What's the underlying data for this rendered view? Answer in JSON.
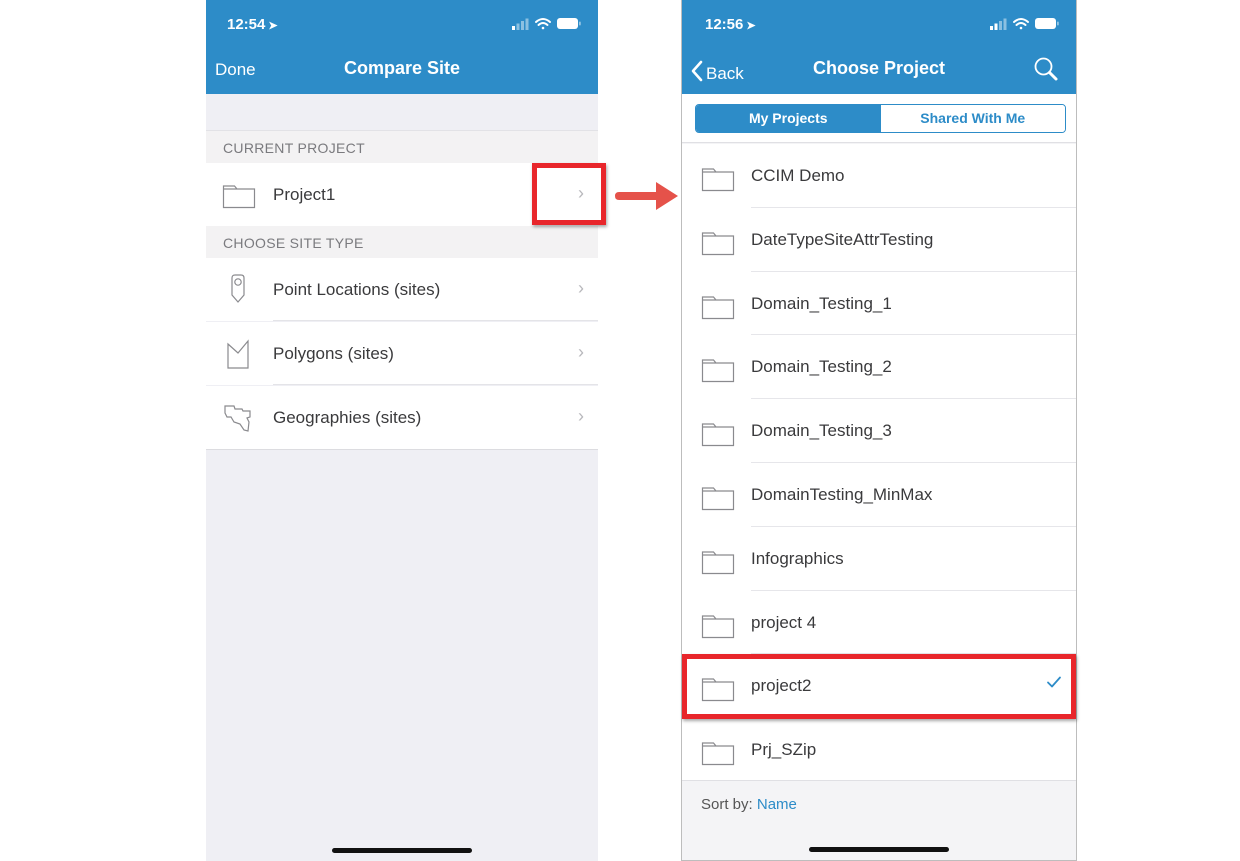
{
  "left_screen": {
    "status_bar": {
      "time": "12:54",
      "location_icon": "location-arrow-icon",
      "signal_icon": "cellular-signal-icon",
      "wifi_icon": "wifi-icon",
      "battery_icon": "battery-icon"
    },
    "nav": {
      "left_button": "Done",
      "title": "Compare Site"
    },
    "sections": {
      "current_project": {
        "header": "CURRENT PROJECT",
        "item": {
          "label": "Project1",
          "icon": "folder-icon",
          "accessory": "chevron-right-icon"
        }
      },
      "choose_site_type": {
        "header": "CHOOSE SITE TYPE",
        "items": [
          {
            "label": "Point Locations (sites)",
            "icon": "map-pin-icon",
            "accessory": "chevron-right-icon"
          },
          {
            "label": "Polygons (sites)",
            "icon": "polygon-icon",
            "accessory": "chevron-right-icon"
          },
          {
            "label": "Geographies (sites)",
            "icon": "geography-shape-icon",
            "accessory": "chevron-right-icon"
          }
        ]
      }
    }
  },
  "right_screen": {
    "status_bar": {
      "time": "12:56",
      "location_icon": "location-arrow-icon",
      "signal_icon": "cellular-signal-icon",
      "wifi_icon": "wifi-icon",
      "battery_icon": "battery-icon"
    },
    "nav": {
      "back_label": "Back",
      "title": "Choose Project",
      "right_icon": "search-icon"
    },
    "segments": [
      {
        "label": "My Projects",
        "selected": true
      },
      {
        "label": "Shared With Me",
        "selected": false
      }
    ],
    "projects": [
      {
        "name": "CCIM Demo",
        "checked": false
      },
      {
        "name": "DateTypeSiteAttrTesting",
        "checked": false
      },
      {
        "name": "Domain_Testing_1",
        "checked": false
      },
      {
        "name": "Domain_Testing_2",
        "checked": false
      },
      {
        "name": "Domain_Testing_3",
        "checked": false
      },
      {
        "name": "DomainTesting_MinMax",
        "checked": false
      },
      {
        "name": "Infographics",
        "checked": false
      },
      {
        "name": "project 4",
        "checked": false
      },
      {
        "name": "project2",
        "checked": true
      },
      {
        "name": "Prj_SZip",
        "checked": false
      }
    ],
    "sort": {
      "label": "Sort by:",
      "value": "Name"
    }
  },
  "annotations": {
    "highlight_color": "#e8262b",
    "arrow_color": "#e5524a",
    "highlights": [
      "current-project-chevron",
      "selected-project-row"
    ]
  },
  "colors": {
    "brand_blue": "#2d8cc8",
    "text": "#3a3a3c",
    "muted": "#7a7a7e"
  }
}
